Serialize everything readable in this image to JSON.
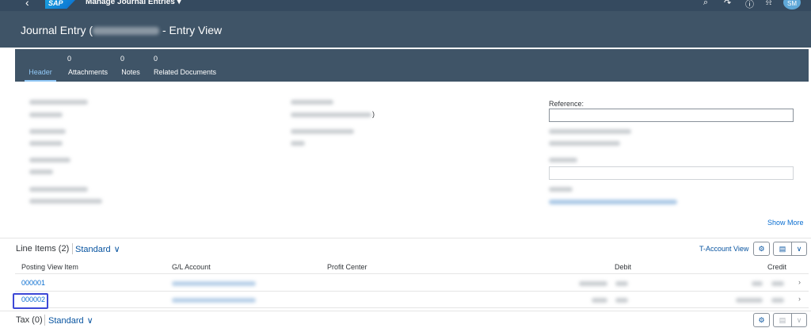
{
  "shell": {
    "app_title": "Manage Journal Entries",
    "title_chevron": "▾",
    "back_icon": "chevron-left-icon",
    "logo_text": "SAP",
    "icons": [
      "search-icon",
      "help-assistant-icon",
      "info-icon",
      "bell-icon"
    ],
    "avatar_initials": "SM"
  },
  "object_header": {
    "title_prefix": "Journal Entry (",
    "title_suffix": "- Entry View"
  },
  "tabs": [
    {
      "label": "Header",
      "count": ""
    },
    {
      "label": "Attachments",
      "count": "0"
    },
    {
      "label": "Notes",
      "count": "0"
    },
    {
      "label": "Related Documents",
      "count": "0"
    }
  ],
  "header_fields": {
    "reference_label": "Reference:",
    "paren_close": ")",
    "show_more": "Show More"
  },
  "line_items": {
    "title": "Line Items (2)",
    "variant": "Standard",
    "t_account_view": "T-Account View",
    "columns": [
      "Posting View Item",
      "G/L Account",
      "Profit Center",
      "Debit",
      "Credit"
    ],
    "rows": [
      {
        "item": "000001"
      },
      {
        "item": "000002"
      }
    ]
  },
  "tax": {
    "title": "Tax (0)",
    "variant": "Standard"
  },
  "colors": {
    "shell": "#354a5f",
    "header_bg": "#3f5467",
    "link": "#0a6ed1",
    "focus": "#3d48d6"
  }
}
